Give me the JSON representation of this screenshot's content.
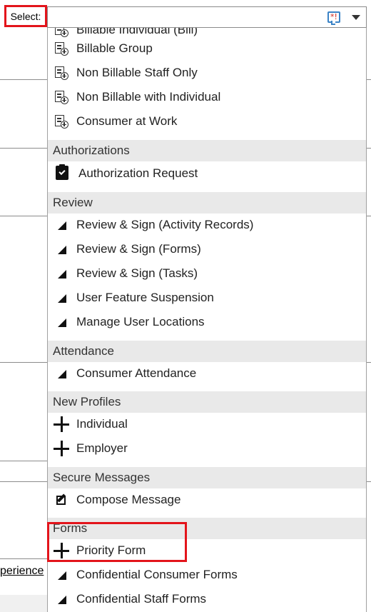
{
  "select": {
    "label": "Select:"
  },
  "background": {
    "partial_link": "perience"
  },
  "menu": {
    "partial_top_label": "Billable Individual (Bill)",
    "billing": [
      {
        "label": "Billable Group",
        "icon": "form-add-icon"
      },
      {
        "label": "Non Billable Staff Only",
        "icon": "form-add-icon"
      },
      {
        "label": "Non Billable with Individual",
        "icon": "form-add-icon"
      },
      {
        "label": "Consumer at Work",
        "icon": "form-add-icon"
      }
    ],
    "authorizations": {
      "header": "Authorizations",
      "items": [
        {
          "label": "Authorization Request",
          "icon": "clipboard-check-icon"
        }
      ]
    },
    "review": {
      "header": "Review",
      "items": [
        {
          "label": "Review & Sign (Activity Records)",
          "icon": "triangle-icon"
        },
        {
          "label": "Review & Sign (Forms)",
          "icon": "triangle-icon"
        },
        {
          "label": "Review & Sign (Tasks)",
          "icon": "triangle-icon"
        },
        {
          "label": "User Feature Suspension",
          "icon": "triangle-icon"
        },
        {
          "label": "Manage User Locations",
          "icon": "triangle-icon"
        }
      ]
    },
    "attendance": {
      "header": "Attendance",
      "items": [
        {
          "label": "Consumer Attendance",
          "icon": "triangle-icon"
        }
      ]
    },
    "new_profiles": {
      "header": "New Profiles",
      "items": [
        {
          "label": "Individual",
          "icon": "plus-icon"
        },
        {
          "label": "Employer",
          "icon": "plus-icon"
        }
      ]
    },
    "secure_messages": {
      "header": "Secure Messages",
      "items": [
        {
          "label": "Compose Message",
          "icon": "compose-icon"
        }
      ]
    },
    "forms": {
      "header": "Forms",
      "items": [
        {
          "label": "Priority Form",
          "icon": "plus-icon"
        },
        {
          "label": "Confidential Consumer Forms",
          "icon": "triangle-icon"
        },
        {
          "label": "Confidential Staff Forms",
          "icon": "triangle-icon"
        }
      ]
    }
  },
  "colors": {
    "highlight": "#e3141b",
    "group_header_bg": "#e9e9e9",
    "required_icon_border": "#3b83c6",
    "required_icon_star": "#d0261b"
  }
}
